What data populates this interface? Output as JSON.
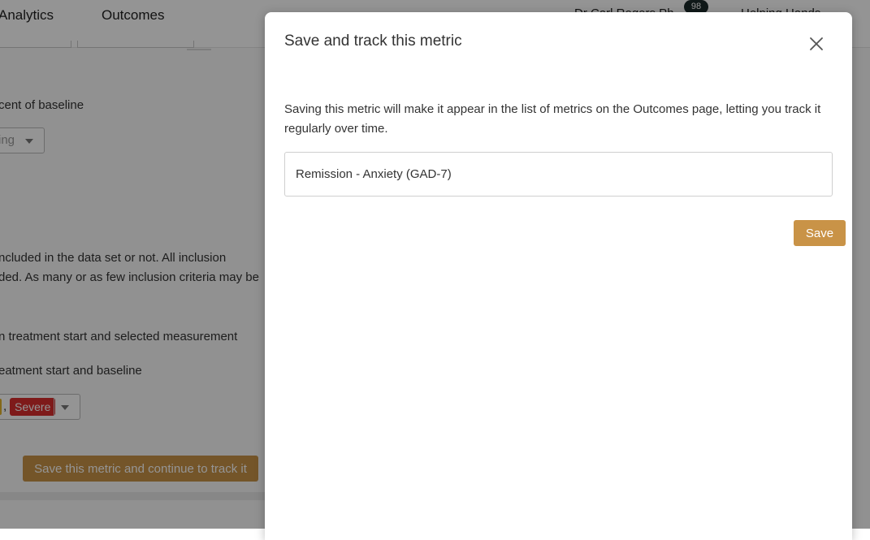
{
  "background": {
    "nav": {
      "analytics": "Analytics",
      "outcomes": "Outcomes",
      "user": "Dr Carl Rogers Ph",
      "badge": "98",
      "org": "Helping Hands"
    },
    "text_percent_baseline": "cent of baseline",
    "select_1_value": "ing",
    "text_included": "ncluded in the data set or not. All inclusion",
    "text_criteria": "ded. As many or as few inclusion criteria may be",
    "text_treatment_measurement": "n treatment start and selected measurement",
    "text_treatment_baseline": "eatment start and baseline",
    "select_2": {
      "comma": ",",
      "tag": "Severe"
    },
    "save_continue_button": "Save this metric and continue to track it"
  },
  "modal": {
    "title": "Save and track this metric",
    "description": "Saving this metric will make it appear in the list of metrics on the Outcomes page, letting you track it regularly over time.",
    "metric_name_value": "Remission - Anxiety (GAD-7)",
    "save_label": "Save"
  },
  "colors": {
    "accent": "#c99347",
    "severe_tag": "#d92d2d",
    "overlay": "rgba(0,0,0,0.42)"
  }
}
